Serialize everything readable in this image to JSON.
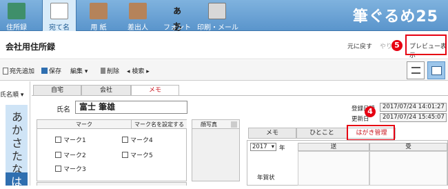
{
  "ribbon": {
    "tabs": [
      {
        "label": "住所録",
        "icon": "address-book-icon",
        "color": "#3f8f6a"
      },
      {
        "label": "宛て名",
        "icon": "address-card-icon",
        "color": "#ffffff",
        "active": true
      },
      {
        "label": "用 紙",
        "icon": "paper-icon",
        "color": "#b5835a"
      },
      {
        "label": "差出人",
        "icon": "sender-icon",
        "color": "#b5835a"
      },
      {
        "label": "フォント",
        "icon": "font-icon",
        "color": "#222222"
      },
      {
        "label": "印刷・メール",
        "icon": "printer-icon",
        "color": "#d8d8d8"
      }
    ],
    "font_glyph": "ぁあ",
    "logo": "筆ぐるめ25"
  },
  "titlebar": {
    "title": "会社用住所録",
    "undo": "元に戻す",
    "redo": "やり",
    "preview": "プレビュー表示",
    "badge_preview": "5"
  },
  "toolbar": {
    "add": "宛先追加",
    "save": "保存",
    "edit": "編集",
    "delete": "削除",
    "search": "検索"
  },
  "left": {
    "sort": "氏名順",
    "kana": [
      "あ",
      "か",
      "さ",
      "た",
      "な",
      "は"
    ]
  },
  "record": {
    "tabs": [
      "自宅",
      "会社",
      "メモ"
    ],
    "name_label": "氏名",
    "name_value": "富士 筆雄",
    "mark_header": "マーク",
    "mark_setting_header": "マーク名を設定する",
    "marks": [
      "マーク1",
      "マーク4",
      "マーク2",
      "マーク5",
      "マーク3"
    ],
    "photo_label": "顔写真",
    "registered_label": "登録日時",
    "registered_value": "2017/07/24 14:01:27",
    "updated_label": "更新日",
    "updated_value": "2017/07/24 15:45:07",
    "sub_tabs": [
      "メモ",
      "ひとこと",
      "はがき管理"
    ],
    "badge_hagaki": "4",
    "year": "2017",
    "year_suffix": "年",
    "send_header": "送",
    "receive_header": "受",
    "nengajo": "年賀状"
  },
  "colors": {
    "accent": "#e60012",
    "ribbon": "#5a95cc"
  }
}
